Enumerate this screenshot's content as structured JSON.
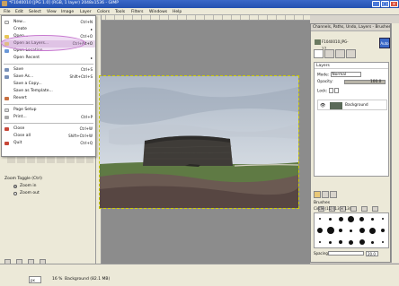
{
  "window": {
    "title": "*F1040010 [JPG 1.0] (RGB, 1 layer) 2048x1536 - GIMP",
    "minimize": "_",
    "maximize": "□",
    "close": "×"
  },
  "menubar": [
    "File",
    "Edit",
    "Select",
    "View",
    "Image",
    "Layer",
    "Colors",
    "Tools",
    "Filters",
    "Windows",
    "Help"
  ],
  "file_menu": {
    "items": [
      {
        "label": "New...",
        "shortcut": "Ctrl+N"
      },
      {
        "label": "Create",
        "shortcut": ""
      },
      {
        "label": "Open...",
        "shortcut": "Ctrl+O"
      },
      {
        "label": "Open as Layers...",
        "shortcut": "Ctrl+Alt+O",
        "highlighted": true
      },
      {
        "label": "Open Location...",
        "shortcut": ""
      },
      {
        "label": "Open Recent",
        "shortcut": ""
      },
      {
        "label": "Save",
        "shortcut": "Ctrl+S"
      },
      {
        "label": "Save As...",
        "shortcut": "Shift+Ctrl+S"
      },
      {
        "label": "Save a Copy...",
        "shortcut": ""
      },
      {
        "label": "Save as Template...",
        "shortcut": ""
      },
      {
        "label": "Revert",
        "shortcut": ""
      },
      {
        "label": "Page Setup",
        "shortcut": ""
      },
      {
        "label": "Print...",
        "shortcut": "Ctrl+P"
      },
      {
        "label": "Close",
        "shortcut": "Ctrl+W"
      },
      {
        "label": "Close all",
        "shortcut": "Shift+Ctrl+W"
      },
      {
        "label": "Quit",
        "shortcut": "Ctrl+Q"
      }
    ]
  },
  "tool_options": {
    "title": "Zoom Toggle (Ctrl)",
    "options": [
      "Zoom in",
      "Zoom out"
    ]
  },
  "status_bar": {
    "unit": "px",
    "zoom": "16 %",
    "info": "Background (82.1 MB)"
  },
  "dock": {
    "title": "Channels, Paths, Undo, Layers - Brushes,...",
    "image_selector": "F1040010.JPG-17",
    "auto_label": "Auto",
    "layers": {
      "heading": "Layers",
      "mode_label": "Mode:",
      "mode_value": "Normal",
      "opacity_label": "Opacity:",
      "opacity_value": "100.0",
      "opacity_fraction": 1.0,
      "lock_label": "Lock:",
      "layer_name": "Background"
    },
    "brushes": {
      "heading": "Brushes",
      "subtitle": "Circle (11) (13 × 13)",
      "spacing_label": "Spacing",
      "spacing_value": "20.0"
    }
  }
}
